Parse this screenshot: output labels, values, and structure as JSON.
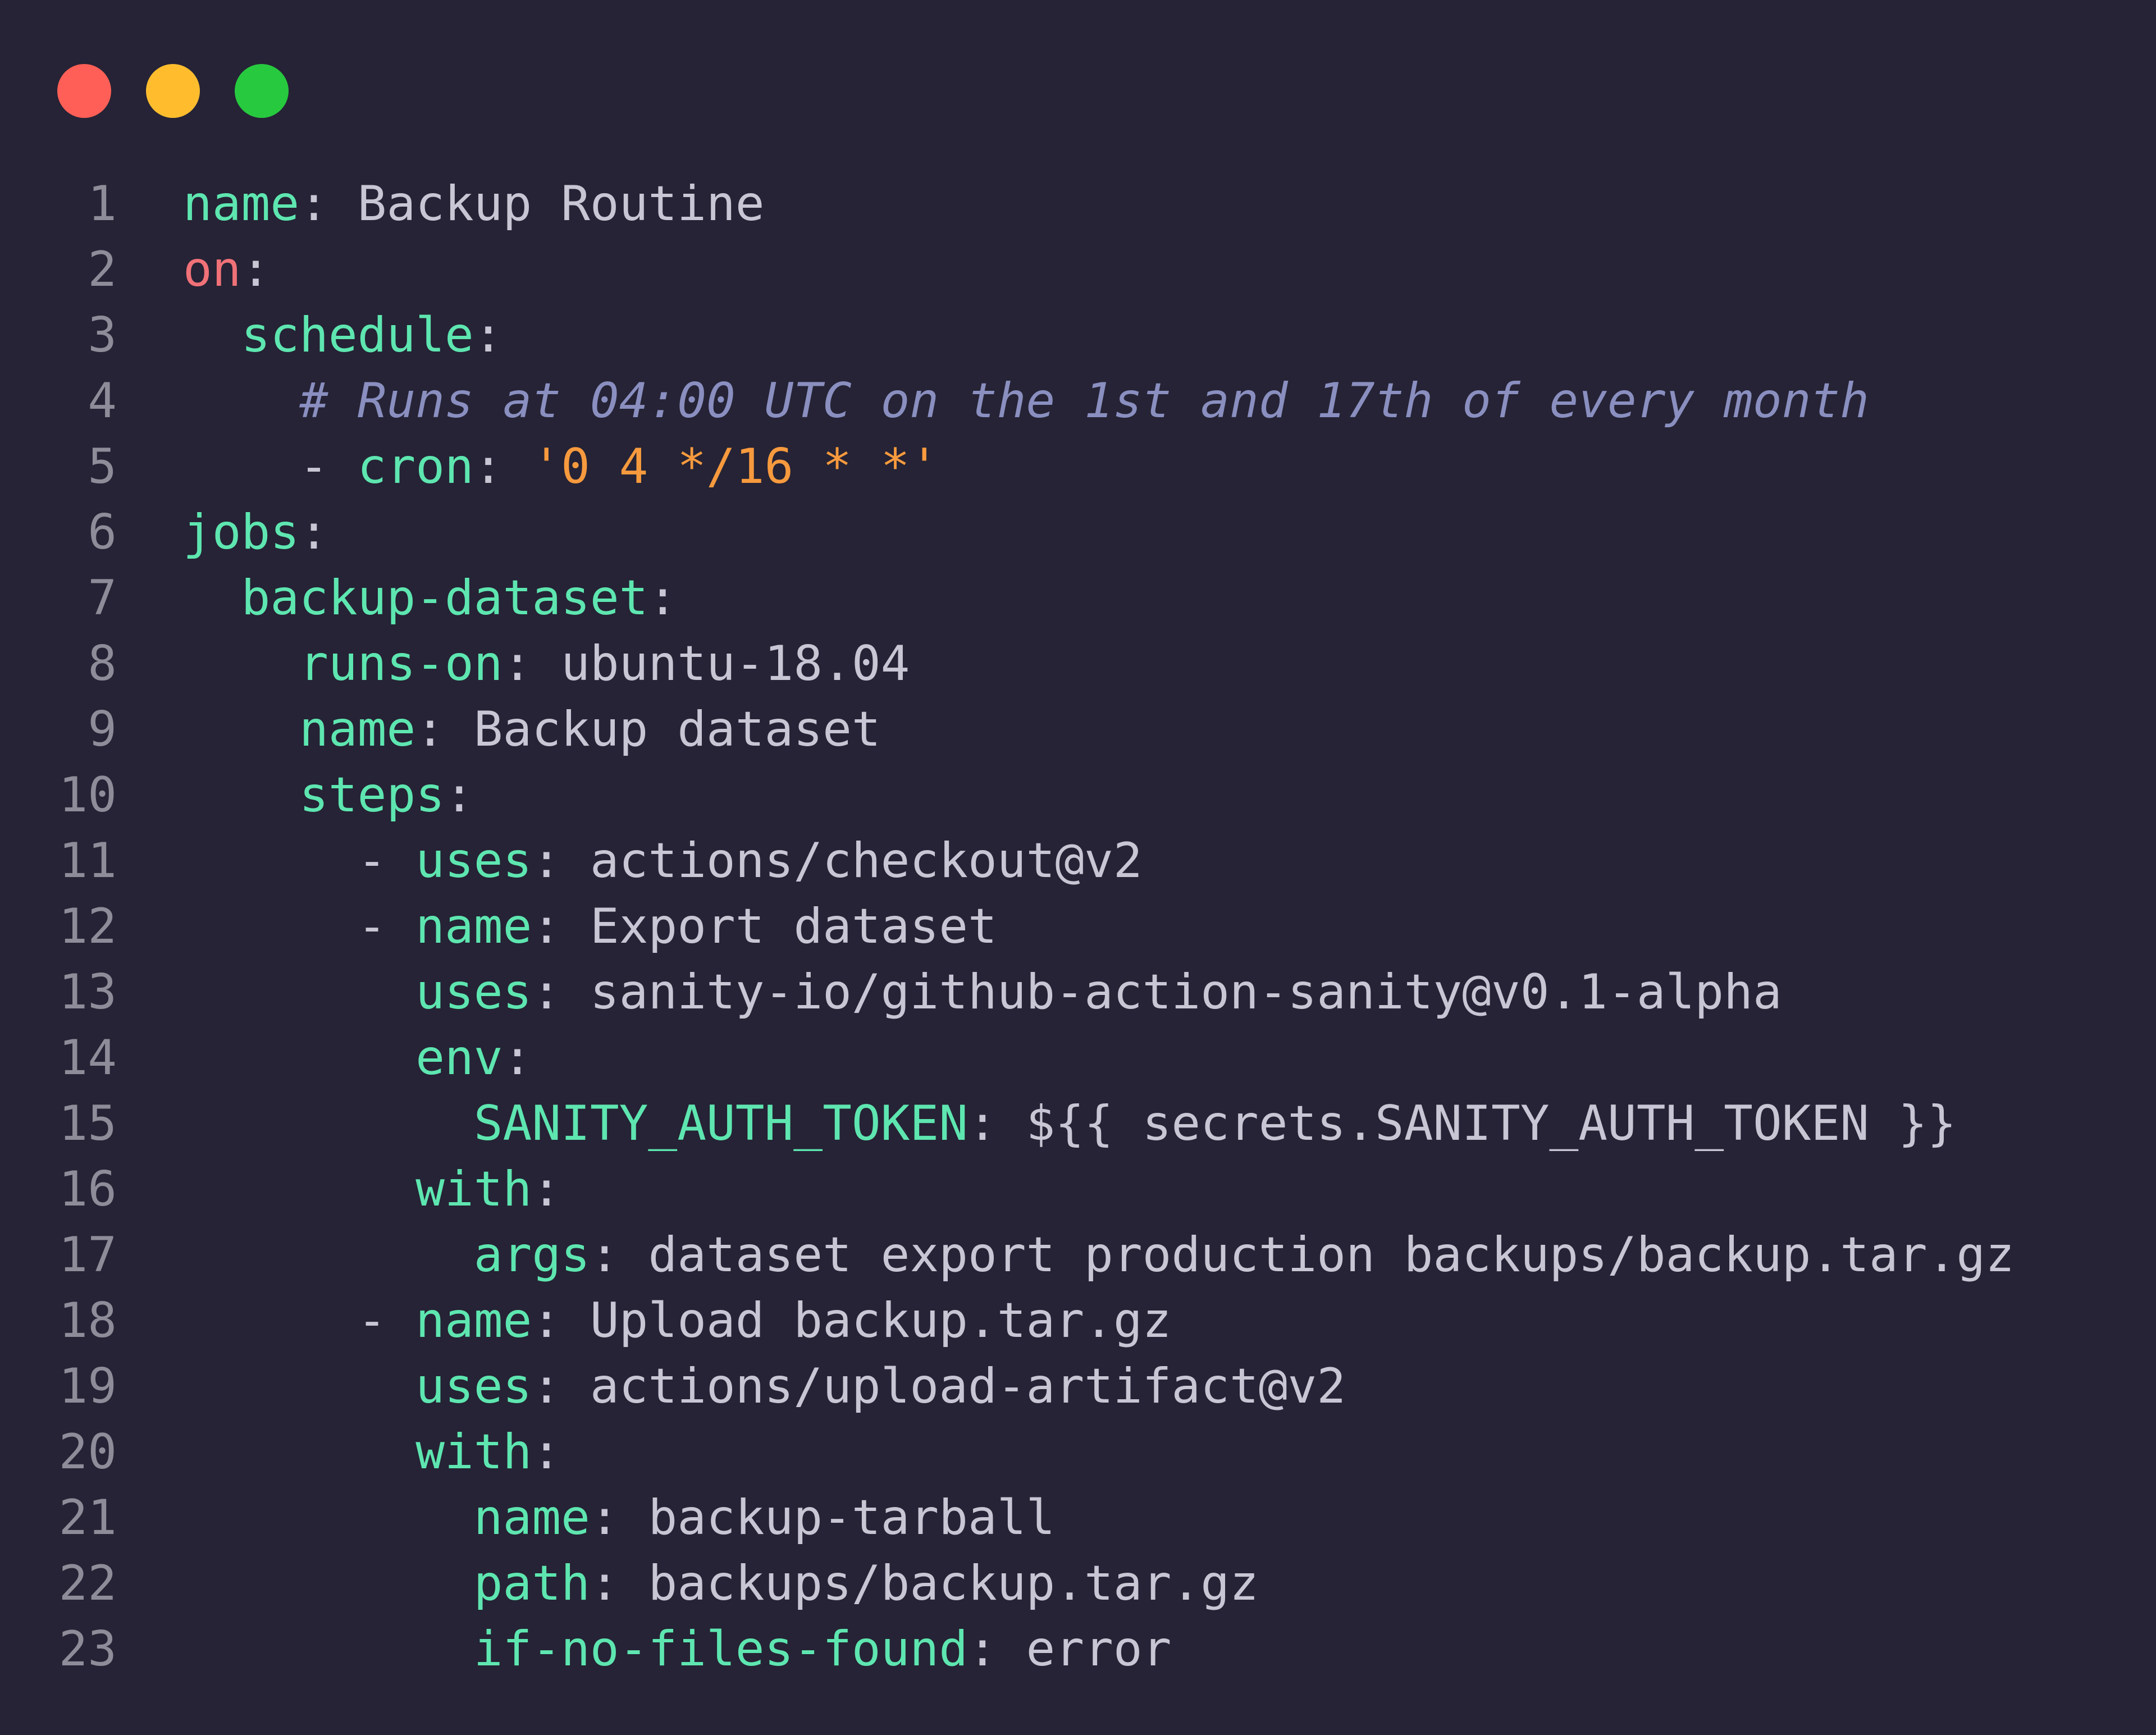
{
  "window_controls": {
    "close_color": "#ff5f56",
    "minimize_color": "#ffbd2e",
    "maximize_color": "#27c93f"
  },
  "editor": {
    "language": "yaml",
    "lines": [
      {
        "n": "1",
        "indent": 0,
        "tokens": [
          {
            "t": "k",
            "v": "name"
          },
          {
            "t": "p",
            "v": ": "
          },
          {
            "t": "v",
            "v": "Backup Routine"
          }
        ]
      },
      {
        "n": "2",
        "indent": 0,
        "tokens": [
          {
            "t": "kw",
            "v": "on"
          },
          {
            "t": "p",
            "v": ":"
          }
        ]
      },
      {
        "n": "3",
        "indent": 2,
        "tokens": [
          {
            "t": "k",
            "v": "schedule"
          },
          {
            "t": "p",
            "v": ":"
          }
        ]
      },
      {
        "n": "4",
        "indent": 4,
        "tokens": [
          {
            "t": "c",
            "v": "# Runs at 04:00 UTC on the 1st and 17th of every month"
          }
        ]
      },
      {
        "n": "5",
        "indent": 4,
        "tokens": [
          {
            "t": "p",
            "v": "- "
          },
          {
            "t": "k",
            "v": "cron"
          },
          {
            "t": "p",
            "v": ": "
          },
          {
            "t": "s",
            "v": "'0 4 */16 * *'"
          }
        ]
      },
      {
        "n": "6",
        "indent": 0,
        "tokens": [
          {
            "t": "k",
            "v": "jobs"
          },
          {
            "t": "p",
            "v": ":"
          }
        ]
      },
      {
        "n": "7",
        "indent": 2,
        "tokens": [
          {
            "t": "k",
            "v": "backup-dataset"
          },
          {
            "t": "p",
            "v": ":"
          }
        ]
      },
      {
        "n": "8",
        "indent": 4,
        "tokens": [
          {
            "t": "k",
            "v": "runs-on"
          },
          {
            "t": "p",
            "v": ": "
          },
          {
            "t": "v",
            "v": "ubuntu-18.04"
          }
        ]
      },
      {
        "n": "9",
        "indent": 4,
        "tokens": [
          {
            "t": "k",
            "v": "name"
          },
          {
            "t": "p",
            "v": ": "
          },
          {
            "t": "v",
            "v": "Backup dataset"
          }
        ]
      },
      {
        "n": "10",
        "indent": 4,
        "tokens": [
          {
            "t": "k",
            "v": "steps"
          },
          {
            "t": "p",
            "v": ":"
          }
        ]
      },
      {
        "n": "11",
        "indent": 6,
        "tokens": [
          {
            "t": "p",
            "v": "- "
          },
          {
            "t": "k",
            "v": "uses"
          },
          {
            "t": "p",
            "v": ": "
          },
          {
            "t": "v",
            "v": "actions/checkout@v2"
          }
        ]
      },
      {
        "n": "12",
        "indent": 6,
        "tokens": [
          {
            "t": "p",
            "v": "- "
          },
          {
            "t": "k",
            "v": "name"
          },
          {
            "t": "p",
            "v": ": "
          },
          {
            "t": "v",
            "v": "Export dataset"
          }
        ]
      },
      {
        "n": "13",
        "indent": 8,
        "tokens": [
          {
            "t": "k",
            "v": "uses"
          },
          {
            "t": "p",
            "v": ": "
          },
          {
            "t": "v",
            "v": "sanity-io/github-action-sanity@v0.1-alpha"
          }
        ]
      },
      {
        "n": "14",
        "indent": 8,
        "tokens": [
          {
            "t": "k",
            "v": "env"
          },
          {
            "t": "p",
            "v": ":"
          }
        ]
      },
      {
        "n": "15",
        "indent": 10,
        "tokens": [
          {
            "t": "k",
            "v": "SANITY_AUTH_TOKEN"
          },
          {
            "t": "p",
            "v": ": "
          },
          {
            "t": "v",
            "v": "${{ secrets.SANITY_AUTH_TOKEN }}"
          }
        ]
      },
      {
        "n": "16",
        "indent": 8,
        "tokens": [
          {
            "t": "k",
            "v": "with"
          },
          {
            "t": "p",
            "v": ":"
          }
        ]
      },
      {
        "n": "17",
        "indent": 10,
        "tokens": [
          {
            "t": "k",
            "v": "args"
          },
          {
            "t": "p",
            "v": ": "
          },
          {
            "t": "v",
            "v": "dataset export production backups/backup.tar.gz"
          }
        ]
      },
      {
        "n": "18",
        "indent": 6,
        "tokens": [
          {
            "t": "p",
            "v": "- "
          },
          {
            "t": "k",
            "v": "name"
          },
          {
            "t": "p",
            "v": ": "
          },
          {
            "t": "v",
            "v": "Upload backup.tar.gz"
          }
        ]
      },
      {
        "n": "19",
        "indent": 8,
        "tokens": [
          {
            "t": "k",
            "v": "uses"
          },
          {
            "t": "p",
            "v": ": "
          },
          {
            "t": "v",
            "v": "actions/upload-artifact@v2"
          }
        ]
      },
      {
        "n": "20",
        "indent": 8,
        "tokens": [
          {
            "t": "k",
            "v": "with"
          },
          {
            "t": "p",
            "v": ":"
          }
        ]
      },
      {
        "n": "21",
        "indent": 10,
        "tokens": [
          {
            "t": "k",
            "v": "name"
          },
          {
            "t": "p",
            "v": ": "
          },
          {
            "t": "v",
            "v": "backup-tarball"
          }
        ]
      },
      {
        "n": "22",
        "indent": 10,
        "tokens": [
          {
            "t": "k",
            "v": "path"
          },
          {
            "t": "p",
            "v": ": "
          },
          {
            "t": "v",
            "v": "backups/backup.tar.gz"
          }
        ]
      },
      {
        "n": "23",
        "indent": 10,
        "tokens": [
          {
            "t": "k",
            "v": "if-no-files-found"
          },
          {
            "t": "p",
            "v": ": "
          },
          {
            "t": "v",
            "v": "error"
          }
        ]
      }
    ]
  }
}
